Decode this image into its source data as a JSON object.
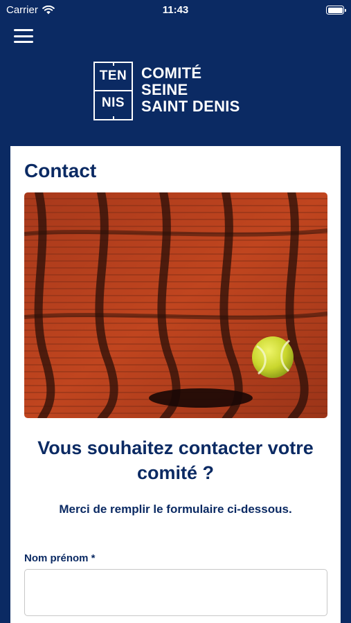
{
  "status_bar": {
    "carrier": "Carrier",
    "time": "11:43",
    "icons": [
      "wifi-icon",
      "battery-icon"
    ]
  },
  "header": {
    "menu_icon": "hamburger-menu-icon",
    "logo": {
      "badge_top": "TEN",
      "badge_bottom": "NIS",
      "line1": "COMITÉ",
      "line2": "SEINE",
      "line3": "SAINT DENIS"
    }
  },
  "page": {
    "title": "Contact",
    "heading": "Vous souhaitez contacter votre comité ?",
    "subheading": "Merci de remplir le formulaire ci-dessous."
  },
  "form": {
    "name_label": "Nom prénom *",
    "name_value": "",
    "name_placeholder": ""
  },
  "colors": {
    "brand_navy": "#0b2a63",
    "clay": "#b8401f",
    "ball": "#d4e03a"
  }
}
